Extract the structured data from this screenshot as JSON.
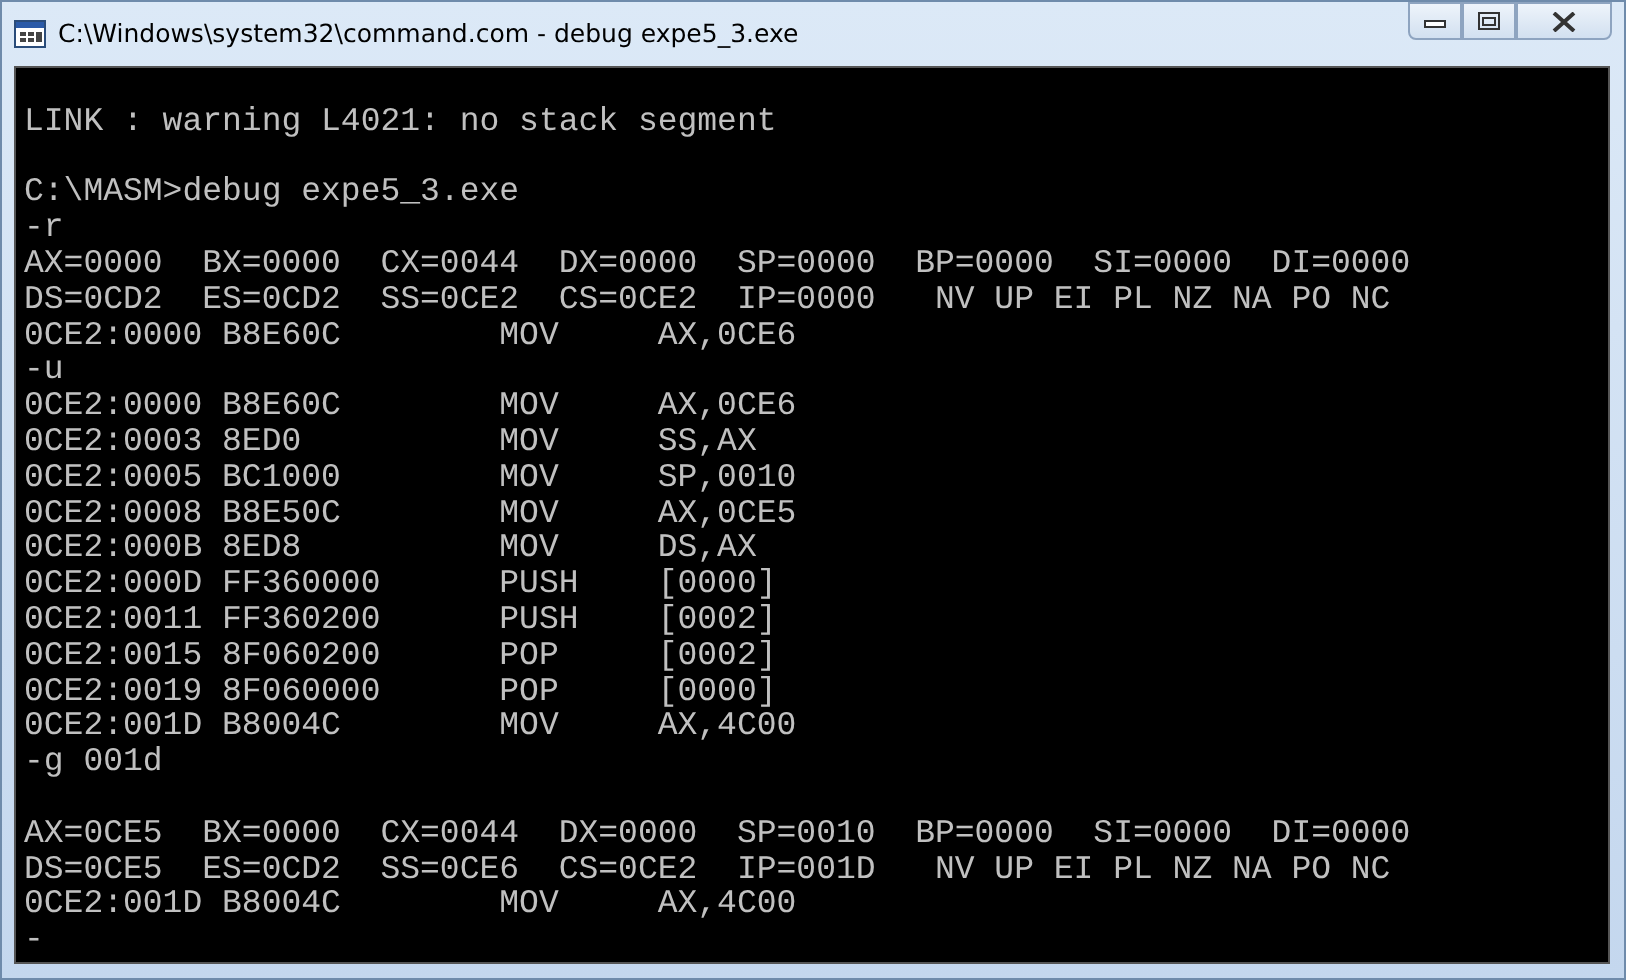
{
  "window": {
    "title": "C:\\Windows\\system32\\command.com - debug expe5_3.exe"
  },
  "console": {
    "lines": [
      {
        "kind": "blank"
      },
      {
        "kind": "text",
        "text": "LINK : warning L4021: no stack segment"
      },
      {
        "kind": "blank"
      },
      {
        "kind": "text",
        "text": "C:\\MASM>debug expe5_3.exe"
      },
      {
        "kind": "text",
        "text": "-r"
      },
      {
        "kind": "text",
        "text": "AX=0000  BX=0000  CX=0044  DX=0000  SP=0000  BP=0000  SI=0000  DI=0000"
      },
      {
        "kind": "text",
        "text": "DS=0CD2  ES=0CD2  SS=0CE2  CS=0CE2  IP=0000   NV UP EI PL NZ NA PO NC"
      },
      {
        "kind": "text",
        "text": "0CE2:0000 B8E60C        MOV     AX,0CE6"
      },
      {
        "kind": "text",
        "text": "-u"
      },
      {
        "kind": "text",
        "text": "0CE2:0000 B8E60C        MOV     AX,0CE6"
      },
      {
        "kind": "text",
        "text": "0CE2:0003 8ED0          MOV     SS,AX"
      },
      {
        "kind": "text",
        "text": "0CE2:0005 BC1000        MOV     SP,0010"
      },
      {
        "kind": "text",
        "text": "0CE2:0008 B8E50C        MOV     AX,0CE5"
      },
      {
        "kind": "text",
        "text": "0CE2:000B 8ED8          MOV     DS,AX"
      },
      {
        "kind": "text",
        "text": "0CE2:000D FF360000      PUSH    [0000]"
      },
      {
        "kind": "text",
        "text": "0CE2:0011 FF360200      PUSH    [0002]"
      },
      {
        "kind": "text",
        "text": "0CE2:0015 8F060200      POP     [0002]"
      },
      {
        "kind": "text",
        "text": "0CE2:0019 8F060000      POP     [0000]"
      },
      {
        "kind": "text",
        "text": "0CE2:001D B8004C        MOV     AX,4C00"
      },
      {
        "kind": "text",
        "text": "-g 001d"
      },
      {
        "kind": "blank"
      },
      {
        "kind": "text",
        "text": "AX=0CE5  BX=0000  CX=0044  DX=0000  SP=0010  BP=0000  SI=0000  DI=0000"
      },
      {
        "kind": "text",
        "text": "DS=0CE5  ES=0CD2  SS=0CE6  CS=0CE2  IP=001D   NV UP EI PL NZ NA PO NC"
      },
      {
        "kind": "text",
        "text": "0CE2:001D B8004C        MOV     AX,4C00"
      },
      {
        "kind": "text",
        "text": "-"
      }
    ]
  }
}
